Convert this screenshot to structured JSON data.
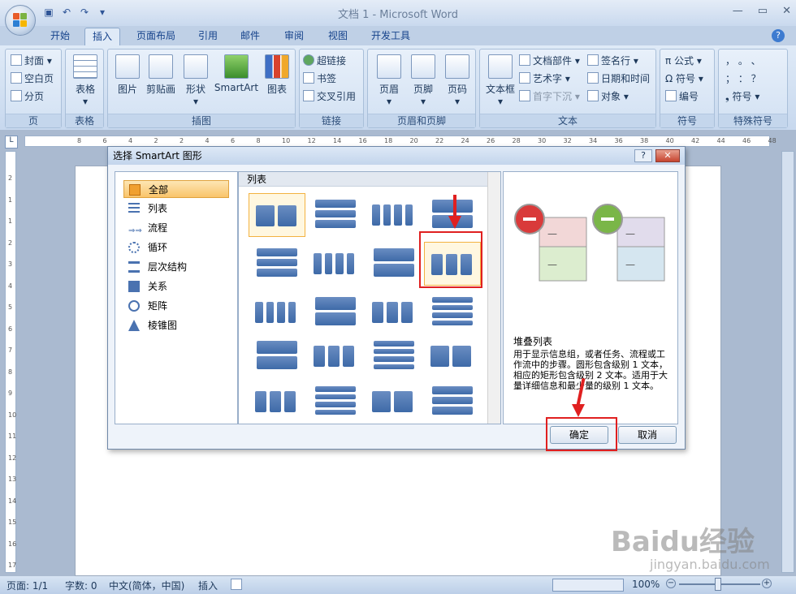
{
  "window": {
    "title": "文档 1 - Microsoft Word"
  },
  "tabs": [
    "开始",
    "插入",
    "页面布局",
    "引用",
    "邮件",
    "审阅",
    "视图",
    "开发工具"
  ],
  "active_tab": "插入",
  "ribbon": {
    "pages": {
      "cover": "封面",
      "blank": "空白页",
      "break": "分页",
      "group": "页"
    },
    "table": {
      "label": "表格",
      "group": "表格"
    },
    "illustrations": {
      "picture": "图片",
      "clipart": "剪贴画",
      "shapes": "形状",
      "smartart": "SmartArt",
      "chart": "图表",
      "group": "插图"
    },
    "links": {
      "hyperlink": "超链接",
      "bookmark": "书签",
      "crossref": "交叉引用",
      "group": "链接"
    },
    "headerfooter": {
      "header": "页眉",
      "footer": "页脚",
      "pagenum": "页码",
      "group": "页眉和页脚"
    },
    "text": {
      "textbox": "文本框",
      "quickparts": "文档部件",
      "wordart": "艺术字",
      "dropcap": "首字下沉",
      "signature": "签名行",
      "datetime": "日期和时间",
      "object": "对象",
      "group": "文本"
    },
    "symbols": {
      "equation": "公式",
      "symbol": "符号",
      "number": "编号",
      "group": "符号"
    },
    "special": {
      "row1": "，  。  、",
      "row2": "；  ：  ？",
      "symbol": "符号",
      "group": "特殊符号"
    }
  },
  "ruler": [
    "8",
    "6",
    "4",
    "2",
    "2",
    "4",
    "6",
    "8",
    "10",
    "12",
    "14",
    "16",
    "18",
    "20",
    "22",
    "24",
    "26",
    "28",
    "30",
    "32",
    "34",
    "36",
    "38",
    "40",
    "42",
    "44",
    "46",
    "48"
  ],
  "vruler": [
    "2",
    "1",
    "1",
    "2",
    "3",
    "4",
    "5",
    "6",
    "7",
    "8",
    "9",
    "10",
    "11",
    "12",
    "13",
    "14",
    "15",
    "16",
    "17"
  ],
  "dialog": {
    "title": "选择 SmartArt 图形",
    "help": "?",
    "close": "✕",
    "categories": [
      "全部",
      "列表",
      "流程",
      "循环",
      "层次结构",
      "关系",
      "矩阵",
      "棱锥图"
    ],
    "selected_category": "全部",
    "gallery_header": "列表",
    "preview_title": "堆叠列表",
    "preview_desc": "用于显示信息组，或者任务、流程或工作流中的步骤。圆形包含级别 1 文本，相应的矩形包含级别 2 文本。适用于大量详细信息和最少量的级别 1 文本。",
    "ok": "确定",
    "cancel": "取消"
  },
  "status": {
    "page": "页面: 1/1",
    "words": "字数: 0",
    "lang": "中文(简体，中国)",
    "mode": "插入",
    "zoom": "100%"
  },
  "watermark": {
    "brand": "Baidu经验",
    "url": "jingyan.baidu.com"
  },
  "colors": {
    "accent_red": "#e02020",
    "preview_red": "#d93a3a",
    "preview_green": "#7ab648",
    "shape_blue": "#4a72b0"
  }
}
